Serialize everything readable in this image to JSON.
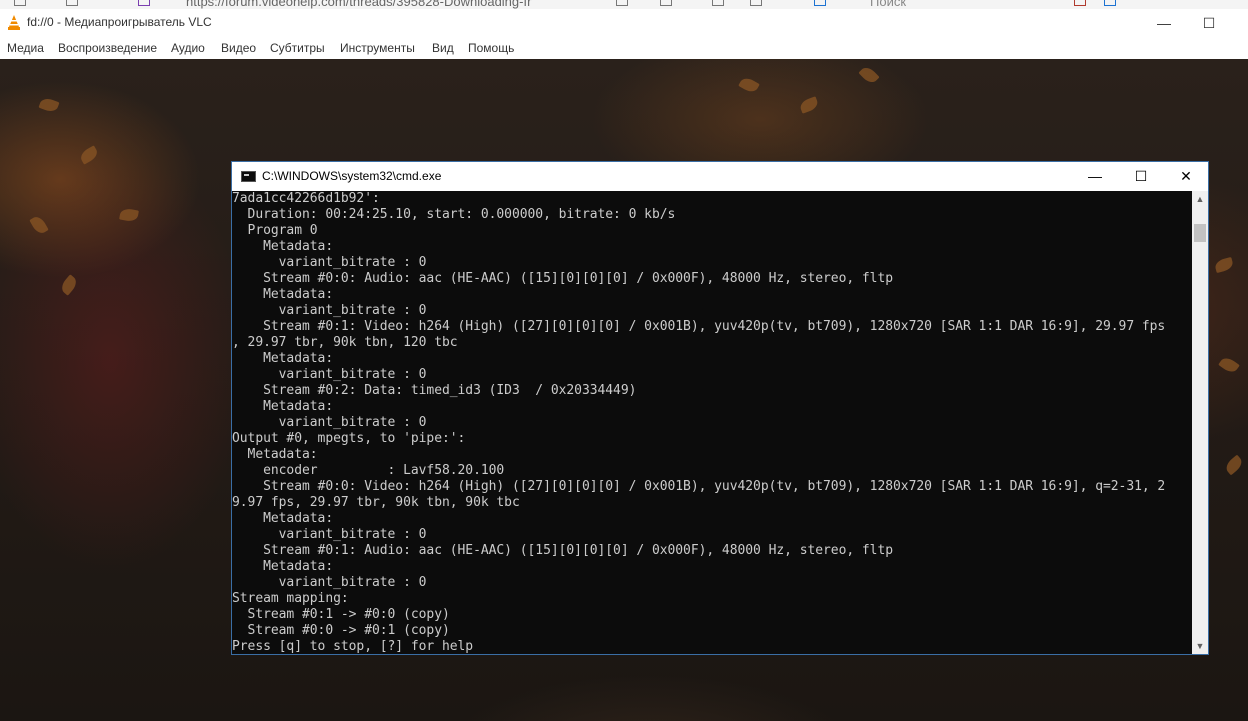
{
  "browser": {
    "url_fragment": "https://forum.videohelp.com/threads/395828-Downloading-fr",
    "search_placeholder": "Поиск"
  },
  "vlc": {
    "title": "fd://0 - Медиапроигрыватель VLC",
    "menu": [
      "Медиа",
      "Воспроизведение",
      "Аудио",
      "Видео",
      "Субтитры",
      "Инструменты",
      "Вид",
      "Помощь"
    ],
    "minimize": "—",
    "maximize": "☐"
  },
  "cmd": {
    "title": "C:\\WINDOWS\\system32\\cmd.exe",
    "minimize": "—",
    "maximize": "☐",
    "close": "✕",
    "lines": [
      "7ada1cc42266d1b92':",
      "  Duration: 00:24:25.10, start: 0.000000, bitrate: 0 kb/s",
      "  Program 0",
      "    Metadata:",
      "      variant_bitrate : 0",
      "    Stream #0:0: Audio: aac (HE-AAC) ([15][0][0][0] / 0x000F), 48000 Hz, stereo, fltp",
      "    Metadata:",
      "      variant_bitrate : 0",
      "    Stream #0:1: Video: h264 (High) ([27][0][0][0] / 0x001B), yuv420p(tv, bt709), 1280x720 [SAR 1:1 DAR 16:9], 29.97 fps",
      ", 29.97 tbr, 90k tbn, 120 tbc",
      "    Metadata:",
      "      variant_bitrate : 0",
      "    Stream #0:2: Data: timed_id3 (ID3  / 0x20334449)",
      "    Metadata:",
      "      variant_bitrate : 0",
      "Output #0, mpegts, to 'pipe:':",
      "  Metadata:",
      "    encoder         : Lavf58.20.100",
      "    Stream #0:0: Video: h264 (High) ([27][0][0][0] / 0x001B), yuv420p(tv, bt709), 1280x720 [SAR 1:1 DAR 16:9], q=2-31, 2",
      "9.97 fps, 29.97 tbr, 90k tbn, 90k tbc",
      "    Metadata:",
      "      variant_bitrate : 0",
      "    Stream #0:1: Audio: aac (HE-AAC) ([15][0][0][0] / 0x000F), 48000 Hz, stereo, fltp",
      "    Metadata:",
      "      variant_bitrate : 0",
      "Stream mapping:",
      "  Stream #0:1 -> #0:0 (copy)",
      "  Stream #0:0 -> #0:1 (copy)",
      "Press [q] to stop, [?] for help"
    ]
  },
  "colors": {
    "console_bg": "#0c0c0c",
    "console_text": "#cccccc",
    "vlc_orange": "#f08a00"
  }
}
